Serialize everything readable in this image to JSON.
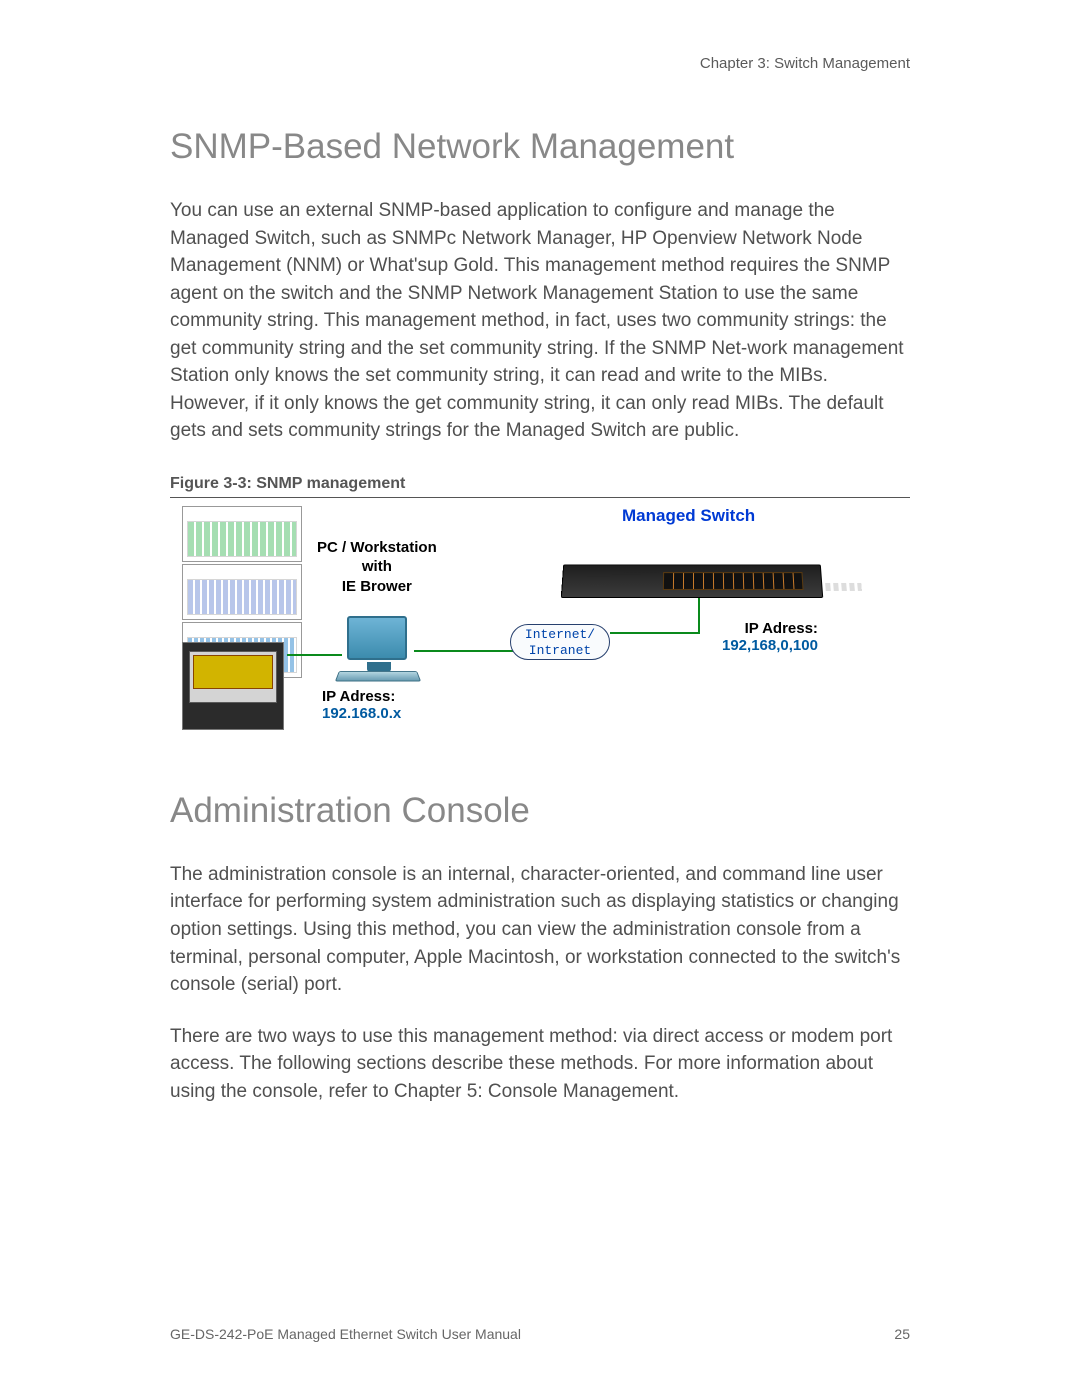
{
  "header": {
    "chapter": "Chapter 3: Switch Management"
  },
  "sections": {
    "snmp": {
      "heading": "SNMP-Based Network Management",
      "body": "You can use an external SNMP-based application to configure and manage the Managed Switch, such as SNMPc Network Manager, HP Openview Network Node Management (NNM) or What'sup Gold. This management method requires the SNMP agent on the switch and the SNMP Network Management Station to use the same community string. This management method, in fact, uses two community strings: the get community string and the set community string. If the SNMP Net-work management Station only knows the set community string, it can read and write to the MIBs. However, if it only knows the get community string, it can only read MIBs. The default gets and sets community strings for the Managed Switch are public."
    },
    "figure": {
      "caption": "Figure 3-3:  SNMP management",
      "pc_label_l1": "PC / Workstation",
      "pc_label_l2": "with",
      "pc_label_l3": "IE Brower",
      "pc_ip_label": "IP Adress:",
      "pc_ip_value": "192.168.0.x",
      "cloud_l1": "Internet/",
      "cloud_l2": "Intranet",
      "switch_title": "Managed Switch",
      "switch_ip_label": "IP Adress:",
      "switch_ip_value": "192,168,0,100"
    },
    "admin": {
      "heading": "Administration Console",
      "body1": "The administration console is an internal, character-oriented, and command line user interface for performing system administration such as displaying statistics or changing option settings. Using this method, you can view the administration console from a terminal, personal computer, Apple Macintosh, or workstation connected to the switch's console (serial) port.",
      "body2": "There are two ways to use this management method: via direct access or modem port access. The following sections describe these methods. For more information about using the console, refer to Chapter 5:  Console Management."
    }
  },
  "footer": {
    "manual": "GE-DS-242-PoE Managed Ethernet Switch User Manual",
    "page": "25"
  }
}
